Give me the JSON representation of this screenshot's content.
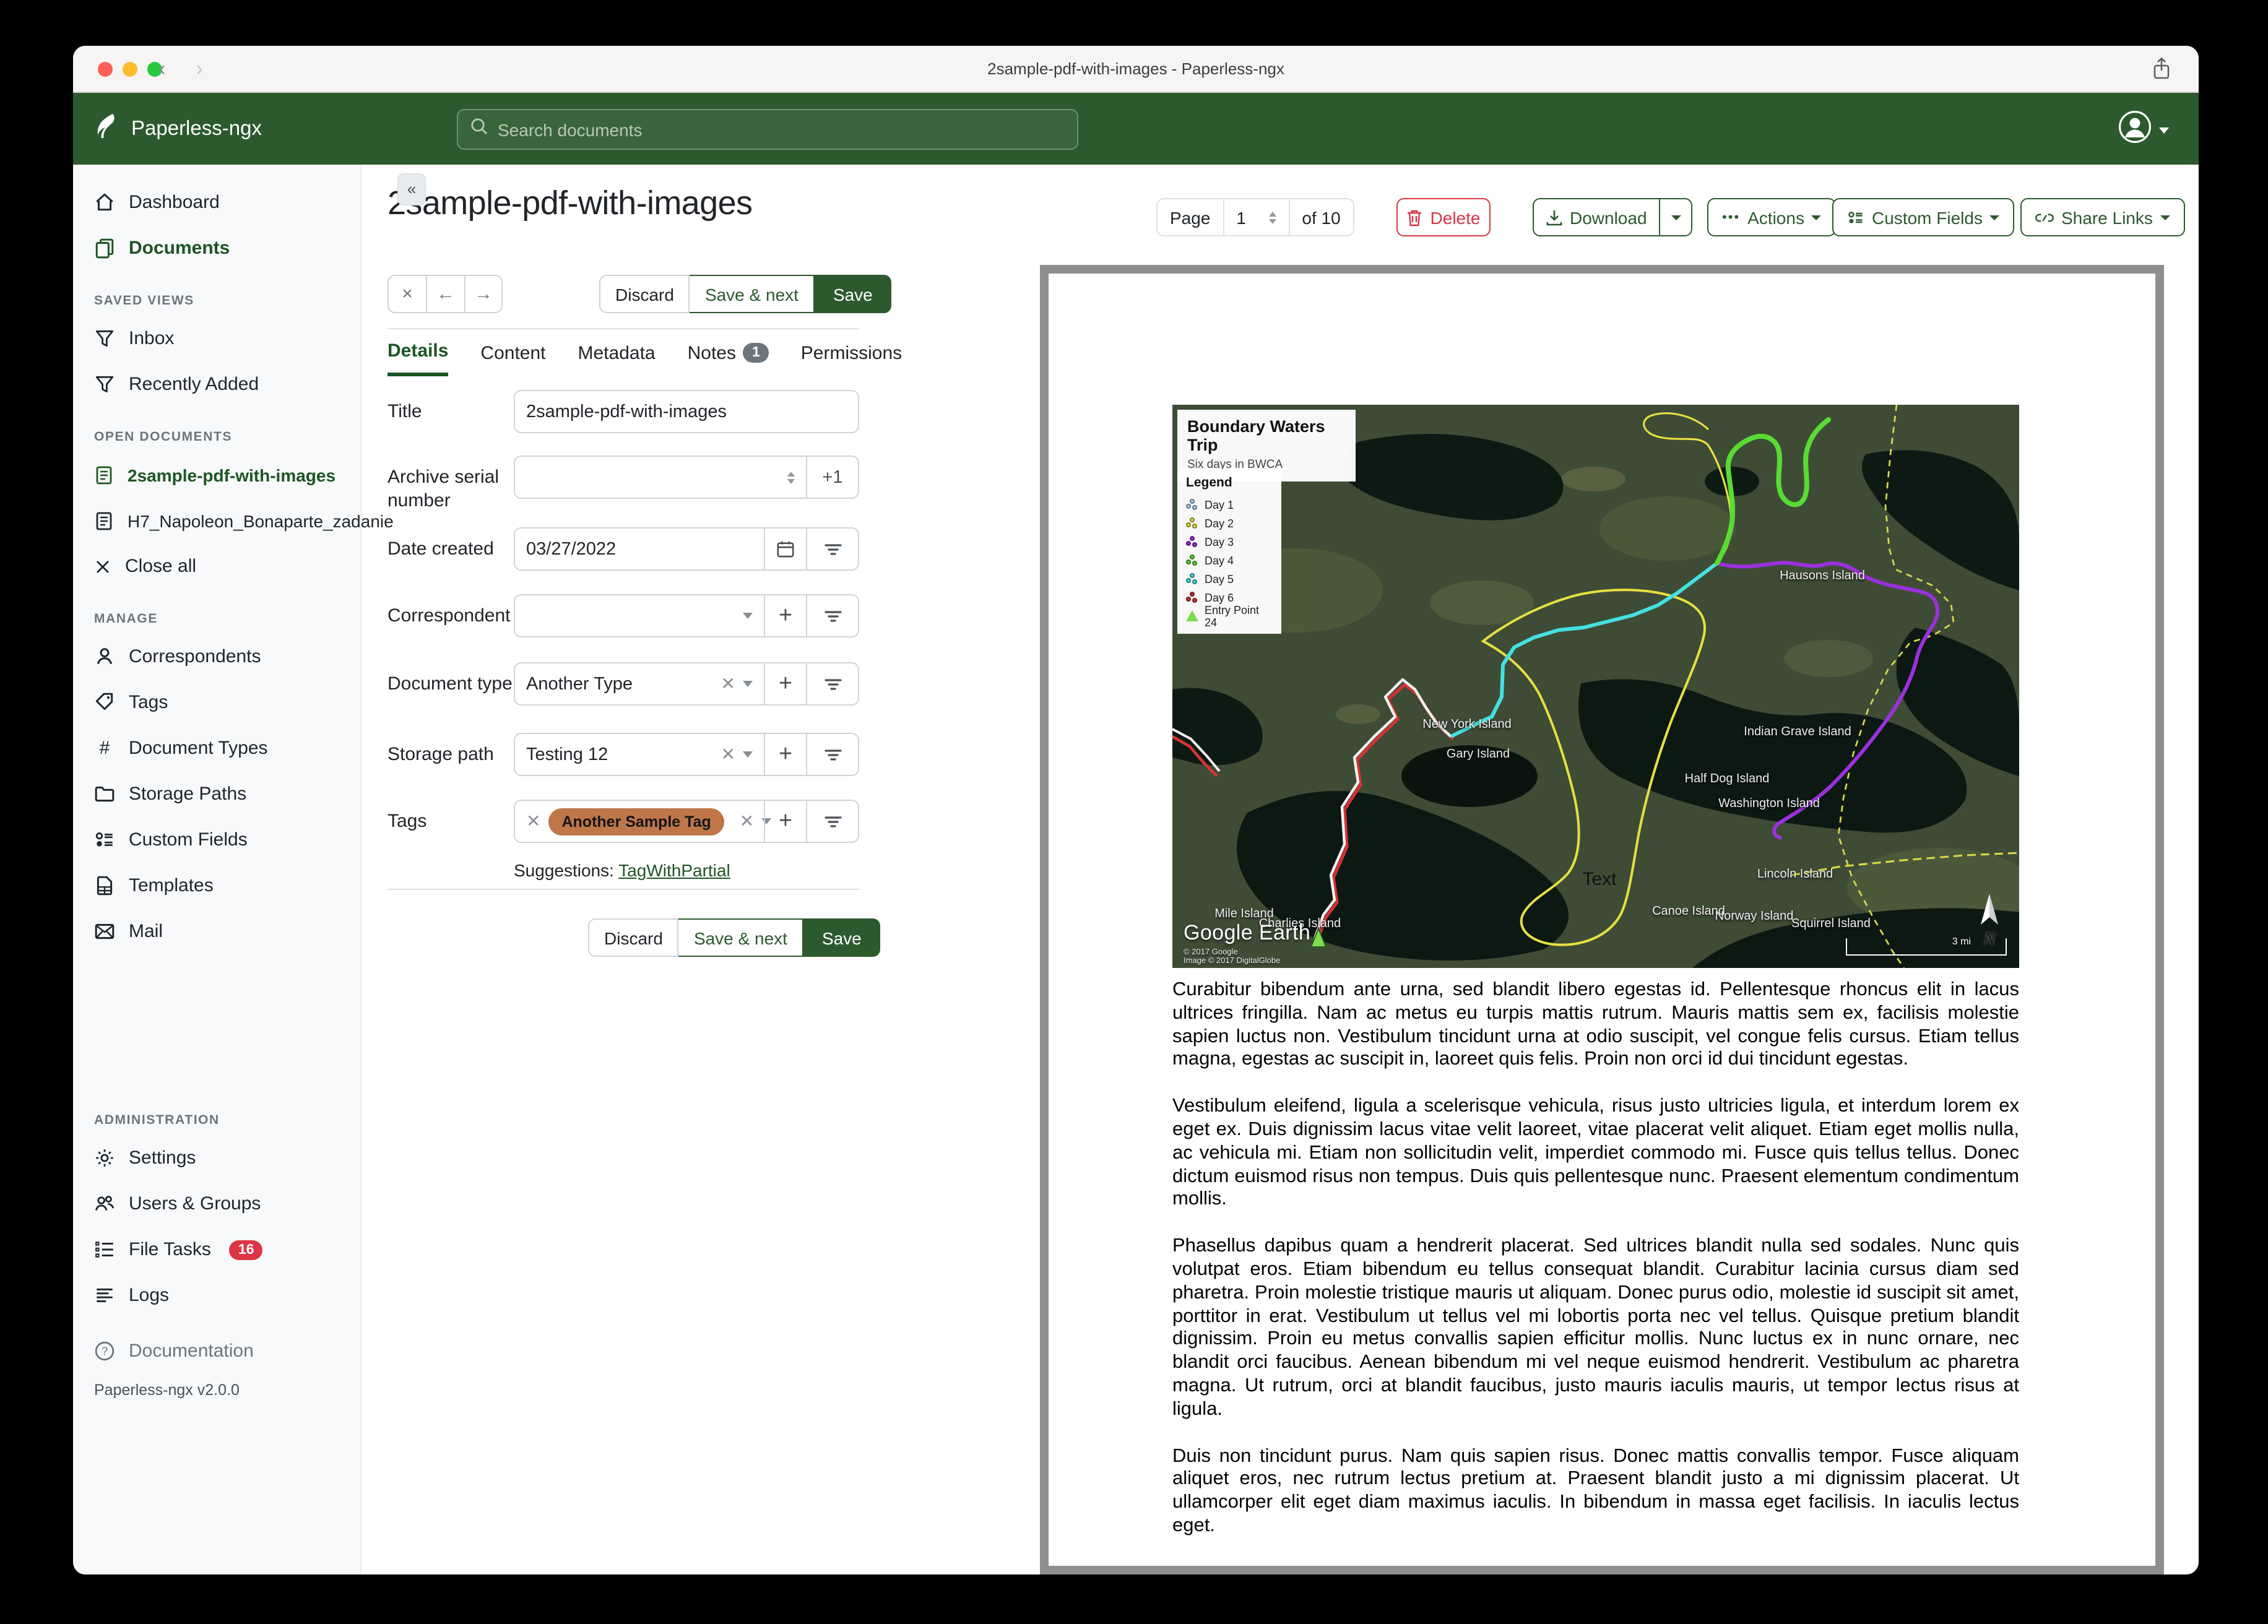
{
  "window": {
    "title": "2sample-pdf-with-images - Paperless-ngx"
  },
  "navbar": {
    "brand": "Paperless-ngx",
    "search_placeholder": "Search documents"
  },
  "sidebar": {
    "dashboard": "Dashboard",
    "documents": "Documents",
    "saved_views_header": "SAVED VIEWS",
    "inbox": "Inbox",
    "recently_added": "Recently Added",
    "open_documents_header": "OPEN DOCUMENTS",
    "open_doc_1": "2sample-pdf-with-images",
    "open_doc_2": "H7_Napoleon_Bonaparte_zadanie",
    "close_all": "Close all",
    "manage_header": "MANAGE",
    "correspondents": "Correspondents",
    "tags": "Tags",
    "document_types": "Document Types",
    "storage_paths": "Storage Paths",
    "custom_fields": "Custom Fields",
    "templates": "Templates",
    "mail": "Mail",
    "administration_header": "ADMINISTRATION",
    "settings": "Settings",
    "users_groups": "Users & Groups",
    "file_tasks": "File Tasks",
    "file_tasks_badge": "16",
    "logs": "Logs",
    "documentation": "Documentation",
    "version": "Paperless-ngx v2.0.0",
    "collapse_glyph": "«"
  },
  "actions": {
    "page_label": "Page",
    "page_value": "1",
    "page_total": "of 10",
    "delete": "Delete",
    "download": "Download",
    "actions": "Actions",
    "actions_dots": "•••",
    "custom_fields": "Custom Fields",
    "share_links": "Share Links"
  },
  "doc": {
    "title": "2sample-pdf-with-images",
    "toolbar": {
      "close": "×",
      "back": "←",
      "forward": "→",
      "discard": "Discard",
      "save_next": "Save & next",
      "save": "Save"
    },
    "tabs": {
      "details": "Details",
      "content": "Content",
      "metadata": "Metadata",
      "notes": "Notes",
      "notes_badge": "1",
      "permissions": "Permissions"
    },
    "form": {
      "title_label": "Title",
      "title_value": "2sample-pdf-with-images",
      "asn_label": "Archive serial number",
      "asn_plus_one": "+1",
      "date_label": "Date created",
      "date_value": "03/27/2022",
      "correspondent_label": "Correspondent",
      "doctype_label": "Document type",
      "doctype_value": "Another Type",
      "storage_label": "Storage path",
      "storage_value": "Testing 12",
      "tags_label": "Tags",
      "tag_chip": "Another Sample Tag",
      "suggestions_label": "Suggestions:",
      "suggestion_link": "TagWithPartial"
    }
  },
  "map": {
    "title": "Boundary Waters Trip",
    "subtitle": "Six days in BWCA",
    "legend_title": "Legend",
    "legend": [
      {
        "label": "Day 1",
        "color": "#a8d7ef"
      },
      {
        "label": "Day 2",
        "color": "#e6e040"
      },
      {
        "label": "Day 3",
        "color": "#9b30dd"
      },
      {
        "label": "Day 4",
        "color": "#58dc33"
      },
      {
        "label": "Day 5",
        "color": "#45e0e0"
      },
      {
        "label": "Day 6",
        "color": "#d43333"
      },
      {
        "label": "Entry Point 24",
        "color": "#7ddc4f"
      }
    ],
    "labels": [
      "Hausons Island",
      "New York Island",
      "Gary Island",
      "Indian Grave Island",
      "Half Dog Island",
      "Washington Island",
      "Lincoln Island",
      "Canoe Island",
      "Norway Island",
      "Squirrel Island",
      "Mile Island",
      "Charlies Island",
      "Text"
    ],
    "attribution_logo": "Google Earth",
    "attribution_1": "© 2017 Google",
    "attribution_2": "Image © 2017 DigitalGlobe",
    "scale_label": "3 mi",
    "compass": "N"
  },
  "document_text": {
    "p1": "Curabitur bibendum ante urna, sed blandit libero egestas id. Pellentesque rhoncus elit in lacus ultrices fringilla. Nam ac metus eu turpis mattis rutrum. Mauris mattis sem ex, facilisis molestie sapien luctus non. Vestibulum tincidunt urna at odio suscipit, vel congue felis cursus. Etiam tellus magna, egestas ac suscipit in, laoreet quis felis. Proin non orci id dui tincidunt egestas.",
    "p2": "Vestibulum eleifend, ligula a scelerisque vehicula, risus justo ultricies ligula, et interdum lorem ex eget ex. Duis dignissim lacus vitae velit laoreet, vitae placerat velit aliquet. Etiam eget mollis nulla, ac vehicula mi. Etiam non sollicitudin velit, imperdiet commodo mi. Fusce quis tellus tellus. Donec dictum euismod risus non tempus. Duis quis pellentesque nunc. Praesent elementum condimentum mollis.",
    "p3": "Phasellus dapibus quam a hendrerit placerat. Sed ultrices blandit nulla sed sodales. Nunc quis volutpat eros. Etiam bibendum eu tellus consequat blandit. Curabitur lacinia cursus diam sed pharetra. Proin molestie tristique mauris ut aliquam. Donec purus odio, molestie id suscipit sit amet, porttitor in erat. Vestibulum ut tellus vel mi lobortis porta nec vel tellus. Quisque pretium blandit dignissim. Proin eu metus convallis sapien efficitur mollis. Nunc luctus ex in nunc ornare, nec blandit orci faucibus. Aenean bibendum mi vel neque euismod hendrerit. Vestibulum ac pharetra magna. Ut rutrum, orci at blandit faucibus, justo mauris iaculis mauris, ut tempor lectus risus at ligula.",
    "p4": "Duis non tincidunt purus. Nam quis sapien risus. Donec mattis convallis tempor. Fusce aliquam aliquet eros, nec rutrum lectus pretium at. Praesent blandit justo a mi dignissim placerat. Ut ullamcorper elit eget diam maximus iaculis. In bibendum in massa eget facilisis. In iaculis lectus eget."
  },
  "colors": {
    "brand_green": "#2c5a2e",
    "accent_green": "#1d5523",
    "danger_red": "#dc3545",
    "tag_orange": "#bf7649",
    "badge_gray": "#6c757d"
  }
}
